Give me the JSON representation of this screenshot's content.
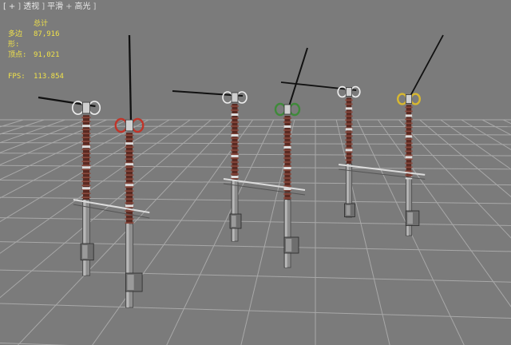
{
  "viewport": {
    "label_parts": [
      {
        "text": "[",
        "name": "viewport-bracket-open"
      },
      {
        "text": "+",
        "name": "viewport-plus-menu"
      },
      {
        "text": "]",
        "name": "viewport-bracket-sep"
      },
      {
        "text": "透视",
        "name": "viewport-view-menu"
      },
      {
        "text": "]",
        "name": "viewport-bracket-sep2"
      },
      {
        "text": "平滑",
        "name": "viewport-shading-menu"
      },
      {
        "text": "+",
        "name": "viewport-plus-sep"
      },
      {
        "text": "高光",
        "name": "viewport-highlight-menu"
      },
      {
        "text": "]",
        "name": "viewport-bracket-close"
      }
    ]
  },
  "stats": {
    "title": "总计",
    "polygons_label": "多边形:",
    "polygons_value": "87,916",
    "vertices_label": "顶点:",
    "vertices_value": "91,021",
    "fps_label": "FPS:",
    "fps_value": "113.854"
  },
  "colors": {
    "background": "#7b7b7b",
    "grid_line": "#a8a8a8",
    "stats_text": "#f0e24a",
    "insulator": "#5a2a22",
    "steel": "#c8c8c8",
    "red_selection": "#c0352a",
    "green_selection": "#3f8a3a",
    "yellow_selection": "#d8b830"
  }
}
